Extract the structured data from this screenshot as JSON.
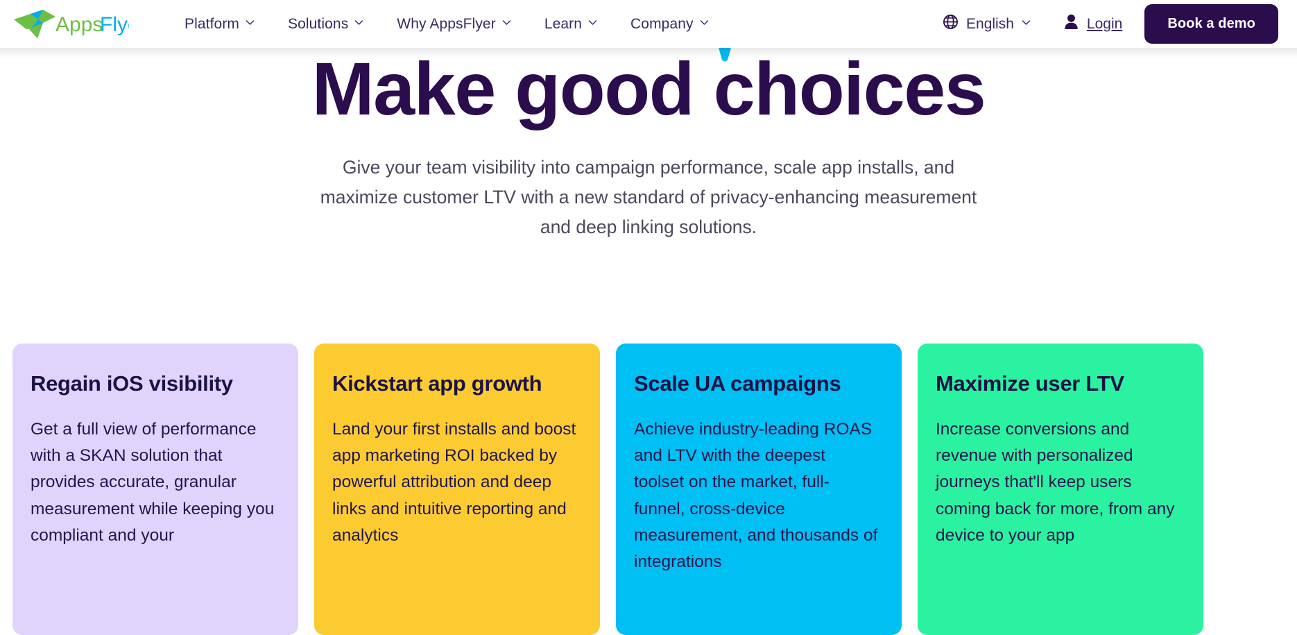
{
  "brand": {
    "name": "AppsFlyer",
    "logo_text_apps": "Apps",
    "logo_text_flyer": "Flyer",
    "logo_green": "#6CBE45",
    "logo_cyan": "#00AEEF",
    "primary_purple": "#2B0D4E",
    "nav_text_color": "#3A2A63"
  },
  "header": {
    "logo_name": "appsflyer-logo",
    "nav": [
      {
        "label": "Platform",
        "has_dropdown": true
      },
      {
        "label": "Solutions",
        "has_dropdown": true
      },
      {
        "label": "Why AppsFlyer",
        "has_dropdown": true
      },
      {
        "label": "Learn",
        "has_dropdown": true
      },
      {
        "label": "Company",
        "has_dropdown": true
      }
    ],
    "language": {
      "icon": "globe-icon",
      "label": "English",
      "has_dropdown": true
    },
    "login": {
      "icon": "user-icon",
      "label": "Login"
    },
    "cta": {
      "label": "Book a demo",
      "bg_color": "#2B0D4E",
      "text_color": "#FFFFFF"
    }
  },
  "hero": {
    "title": "Make good choices",
    "accent_color": "#00BCF2",
    "subtitle": "Give your team visibility into campaign performance, scale app installs, and maximize customer LTV with a new standard of privacy-enhancing measurement and deep linking solutions."
  },
  "cards": [
    {
      "title": "Regain iOS visibility",
      "body": "Get a full view of performance with a SKAN solution that provides accurate, granular measurement while keeping you compliant and your",
      "bg_color": "#E0D4FC"
    },
    {
      "title": "Kickstart app growth",
      "body": "Land your first installs and boost app marketing ROI backed by powerful attribution and deep links and intuitive reporting and analytics",
      "bg_color": "#FBCB31"
    },
    {
      "title": "Scale UA campaigns",
      "body": "Achieve industry-leading ROAS and LTV with the deepest toolset on the market, full-funnel, cross-device measurement, and thousands of integrations",
      "bg_color": "#00BFF3"
    },
    {
      "title": "Maximize user LTV",
      "body": "Increase conversions and revenue with personalized journeys that'll keep users coming back for more, from any device to your app",
      "bg_color": "#2BF2A0"
    }
  ]
}
